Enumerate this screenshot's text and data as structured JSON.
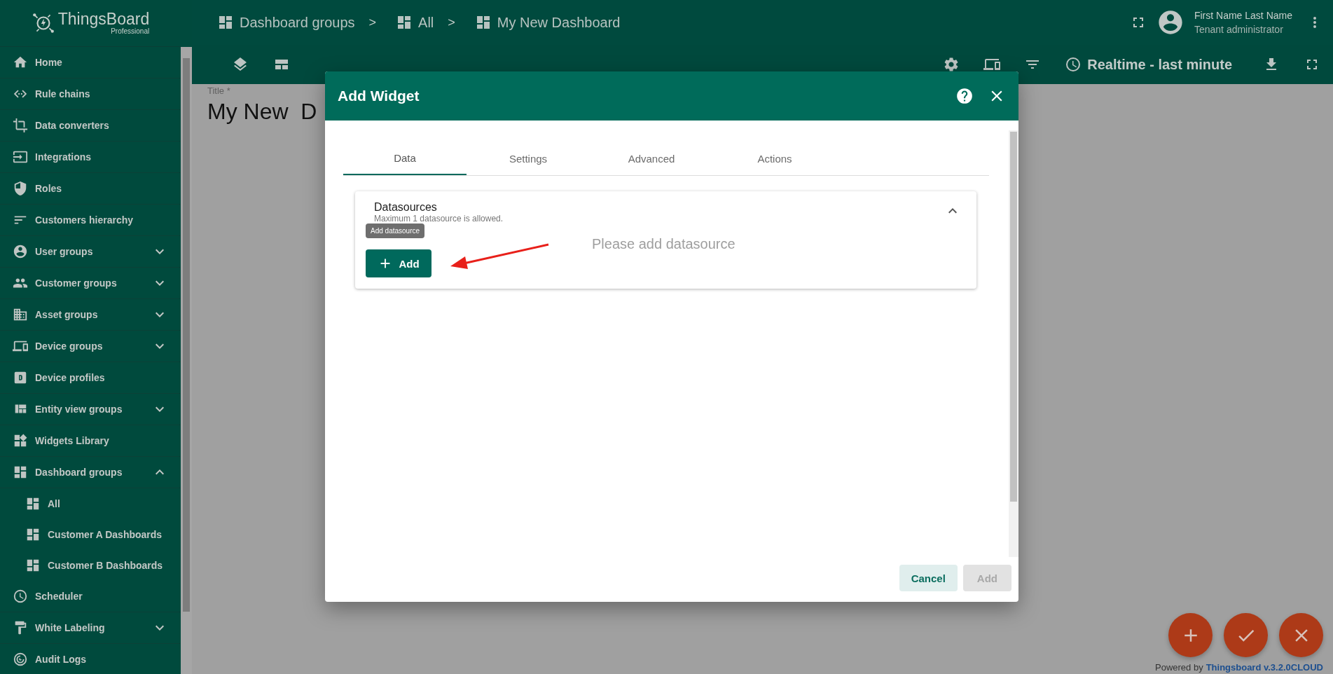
{
  "logo": {
    "name": "ThingsBoard",
    "edition": "Professional"
  },
  "breadcrumbs": [
    {
      "label": "Dashboard groups"
    },
    {
      "separator": ">",
      "label": "All"
    },
    {
      "separator": ">",
      "label": "My New Dashboard"
    }
  ],
  "user": {
    "name": "First Name Last Name",
    "role": "Tenant administrator"
  },
  "sidebar": {
    "items": [
      {
        "label": "Home"
      },
      {
        "label": "Rule chains"
      },
      {
        "label": "Data converters"
      },
      {
        "label": "Integrations"
      },
      {
        "label": "Roles"
      },
      {
        "label": "Customers hierarchy"
      },
      {
        "label": "User groups",
        "expanded": false
      },
      {
        "label": "Customer groups",
        "expanded": false
      },
      {
        "label": "Asset groups",
        "expanded": false
      },
      {
        "label": "Device groups",
        "expanded": false
      },
      {
        "label": "Device profiles"
      },
      {
        "label": "Entity view groups",
        "expanded": false
      },
      {
        "label": "Widgets Library"
      },
      {
        "label": "Dashboard groups",
        "expanded": true,
        "children": [
          {
            "label": "All"
          },
          {
            "label": "Customer A Dashboards"
          },
          {
            "label": "Customer B Dashboards"
          }
        ]
      },
      {
        "label": "Scheduler"
      },
      {
        "label": "White Labeling",
        "expanded": false
      },
      {
        "label": "Audit Logs"
      }
    ]
  },
  "toolbar": {
    "timewindow": "Realtime - last minute"
  },
  "dashboard": {
    "title_label": "Title *",
    "title": "My New  D"
  },
  "dialog": {
    "title": "Add Widget",
    "tabs": [
      {
        "label": "Data",
        "selected": true
      },
      {
        "label": "Settings",
        "selected": false
      },
      {
        "label": "Advanced",
        "selected": false
      },
      {
        "label": "Actions",
        "selected": false
      }
    ],
    "datasources": {
      "title": "Datasources",
      "hint": "Maximum 1 datasource is allowed.",
      "expanded": true,
      "tooltip": "Add datasource",
      "add_button": "Add",
      "empty_text": "Please add datasource"
    },
    "buttons": [
      {
        "label": "Cancel",
        "disabled": false
      },
      {
        "label": "Add",
        "disabled": true
      }
    ]
  },
  "footer": {
    "prefix": "Powered by",
    "link": "Thingsboard v.3.2.0CLOUD"
  }
}
